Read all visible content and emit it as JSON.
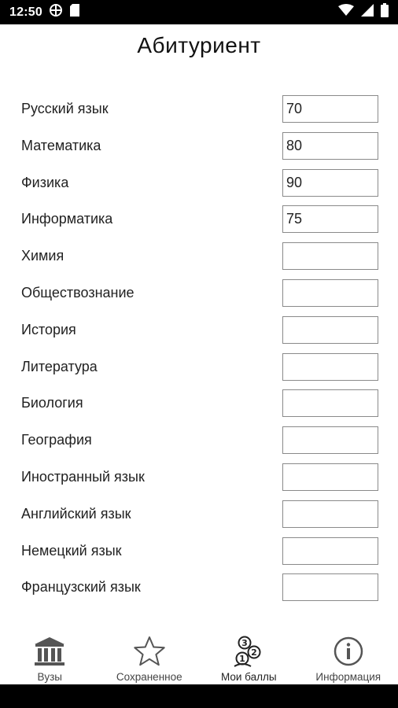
{
  "status_bar": {
    "time": "12:50",
    "left_icons": [
      "vpn-globe-icon",
      "sd-card-icon"
    ],
    "right_icons": [
      "wifi-icon",
      "cellular-signal-icon",
      "battery-icon"
    ]
  },
  "page": {
    "title": "Абитуриент"
  },
  "subjects": [
    {
      "label": "Русский язык",
      "value": "70"
    },
    {
      "label": "Математика",
      "value": "80"
    },
    {
      "label": "Физика",
      "value": "90"
    },
    {
      "label": "Информатика",
      "value": "75"
    },
    {
      "label": "Химия",
      "value": ""
    },
    {
      "label": "Обществознание",
      "value": ""
    },
    {
      "label": "История",
      "value": ""
    },
    {
      "label": "Литература",
      "value": ""
    },
    {
      "label": "Биология",
      "value": ""
    },
    {
      "label": "География",
      "value": ""
    },
    {
      "label": "Иностранный язык",
      "value": ""
    },
    {
      "label": "Английский язык",
      "value": ""
    },
    {
      "label": "Немецкий язык",
      "value": ""
    },
    {
      "label": "Французский язык",
      "value": ""
    }
  ],
  "bottom_nav": {
    "items": [
      {
        "label": "Вузы",
        "icon": "university-building-icon"
      },
      {
        "label": "Сохраненное",
        "icon": "star-outline-icon"
      },
      {
        "label": "Мои баллы",
        "icon": "score-bubbles-icon"
      },
      {
        "label": "Информация",
        "icon": "info-circle-icon"
      }
    ]
  },
  "colors": {
    "status_bar_bg": "#000000",
    "background": "#ffffff",
    "input_border": "#8a8a8a",
    "text": "#222222"
  }
}
